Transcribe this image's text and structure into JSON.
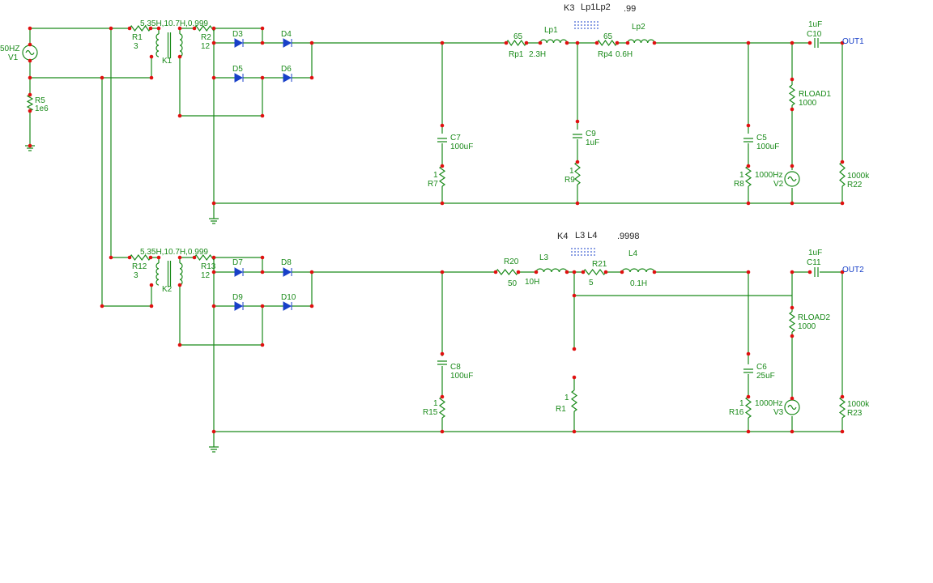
{
  "upper": {
    "source": {
      "freq": "50HZ",
      "name": "V1"
    },
    "r5": {
      "name": "R5",
      "value": "1e6"
    },
    "r1": {
      "name": "R1",
      "value": "3"
    },
    "k1": {
      "name": "K1",
      "spec": "5.35H,10.7H,0.999"
    },
    "r2": {
      "name": "R2",
      "value": "12"
    },
    "diodes": [
      "D3",
      "D4",
      "D5",
      "D6"
    ],
    "c7": {
      "name": "C7",
      "value": "100uF"
    },
    "r7": {
      "name": "R7",
      "value": "1"
    },
    "rp1": {
      "name": "Rp1",
      "value": "65"
    },
    "lp1": {
      "name": "Lp1",
      "value": "2.3H"
    },
    "k3": {
      "name": "K3",
      "inductors": "Lp1Lp2",
      "coupling": ".99"
    },
    "rp4": {
      "name": "Rp4",
      "value": "65"
    },
    "lp2": {
      "name": "Lp2",
      "value": "0.6H"
    },
    "c9": {
      "name": "C9",
      "value": "1uF"
    },
    "r9": {
      "name": "R9",
      "value": "1"
    },
    "c5": {
      "name": "C5",
      "value": "100uF"
    },
    "r8": {
      "name": "R8",
      "value": "1"
    },
    "rload1": {
      "name": "RLOAD1",
      "value": "1000"
    },
    "v2": {
      "name": "V2",
      "freq": "1000Hz"
    },
    "c10": {
      "name": "C10",
      "value": "1uF"
    },
    "out": "OUT1",
    "r22": {
      "name": "R22",
      "value": "1000k"
    }
  },
  "lower": {
    "r12": {
      "name": "R12",
      "value": "3"
    },
    "k2": {
      "name": "K2",
      "spec": "5.35H,10.7H,0.999"
    },
    "r13": {
      "name": "R13",
      "value": "12"
    },
    "diodes": [
      "D7",
      "D8",
      "D9",
      "D10"
    ],
    "c8": {
      "name": "C8",
      "value": "100uF"
    },
    "r15": {
      "name": "R15",
      "value": "1"
    },
    "r20": {
      "name": "R20",
      "value": "50"
    },
    "l3": {
      "name": "L3",
      "value": "10H"
    },
    "k4": {
      "name": "K4",
      "inductors": "L3 L4",
      "coupling": ".9998"
    },
    "r21": {
      "name": "R21",
      "value": "5"
    },
    "l4": {
      "name": "L4",
      "value": "0.1H"
    },
    "r1x": {
      "name": "R1",
      "value": "1"
    },
    "c6": {
      "name": "C6",
      "value": "25uF"
    },
    "r16": {
      "name": "R16",
      "value": "1"
    },
    "rload2": {
      "name": "RLOAD2",
      "value": "1000"
    },
    "v3": {
      "name": "V3",
      "freq": "1000Hz"
    },
    "c11": {
      "name": "C11",
      "value": "1uF"
    },
    "out": "OUT2",
    "r23": {
      "name": "R23",
      "value": "1000k"
    }
  }
}
